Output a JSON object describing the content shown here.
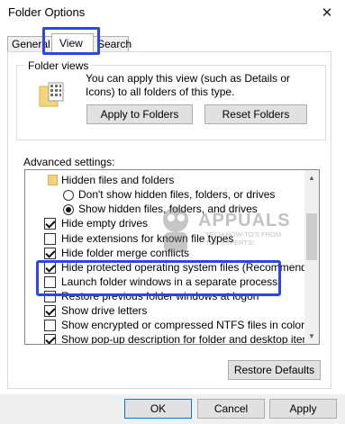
{
  "window": {
    "title": "Folder Options",
    "close_icon": "close-icon"
  },
  "tabs": [
    {
      "label": "General",
      "selected": false
    },
    {
      "label": "View",
      "selected": true
    },
    {
      "label": "Search",
      "selected": false
    }
  ],
  "folder_views": {
    "group_label": "Folder views",
    "description": "You can apply this view (such as Details or Icons) to all folders of this type.",
    "apply_button": "Apply to Folders",
    "reset_button": "Reset Folders"
  },
  "advanced": {
    "label": "Advanced settings:",
    "items": [
      {
        "type": "folder",
        "label": "Hidden files and folders"
      },
      {
        "type": "radio",
        "label": "Don't show hidden files, folders, or drives",
        "checked": false
      },
      {
        "type": "radio",
        "label": "Show hidden files, folders, and drives",
        "checked": true
      },
      {
        "type": "checkbox",
        "label": "Hide empty drives",
        "checked": true
      },
      {
        "type": "checkbox",
        "label": "Hide extensions for known file types",
        "checked": false
      },
      {
        "type": "checkbox",
        "label": "Hide folder merge conflicts",
        "checked": true
      },
      {
        "type": "checkbox",
        "label": "Hide protected operating system files (Recommended)",
        "checked": true
      },
      {
        "type": "checkbox",
        "label": "Launch folder windows in a separate process",
        "checked": false
      },
      {
        "type": "checkbox",
        "label": "Restore previous folder windows at logon",
        "checked": false
      },
      {
        "type": "checkbox",
        "label": "Show drive letters",
        "checked": true
      },
      {
        "type": "checkbox",
        "label": "Show encrypted or compressed NTFS files in color",
        "checked": false
      },
      {
        "type": "checkbox",
        "label": "Show pop-up description for folder and desktop items",
        "checked": true
      }
    ],
    "restore_button": "Restore Defaults"
  },
  "watermark": {
    "title": "APPUALS",
    "subtitle": "TECH HOW-TO'S FROM THE EXPERTS!"
  },
  "footer": {
    "ok": "OK",
    "cancel": "Cancel",
    "apply": "Apply"
  },
  "colors": {
    "highlight": "#2d46e6",
    "folder": "#f2d27a"
  }
}
